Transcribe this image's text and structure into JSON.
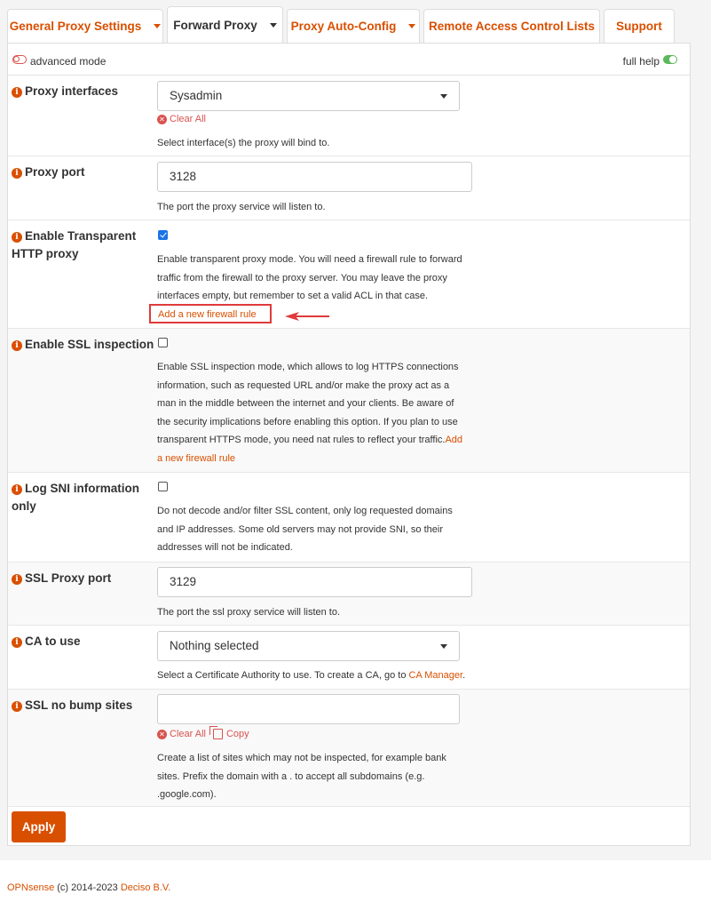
{
  "tabs": [
    {
      "label": "General Proxy Settings"
    },
    {
      "label": "Forward Proxy"
    },
    {
      "label": "Proxy Auto-Config"
    },
    {
      "label": "Remote Access Control Lists"
    },
    {
      "label": "Support"
    }
  ],
  "modebar": {
    "left": "advanced mode",
    "right": "full help"
  },
  "fields": {
    "proxy_interfaces": {
      "label": "Proxy interfaces",
      "value": "Sysadmin",
      "clear": "Clear All",
      "help": "Select interface(s) the proxy will bind to."
    },
    "proxy_port": {
      "label": "Proxy port",
      "value": "3128",
      "help": "The port the proxy service will listen to."
    },
    "transparent": {
      "label": "Enable Transparent HTTP proxy",
      "checked": true,
      "help": "Enable transparent proxy mode. You will need a firewall rule to forward traffic from the firewall to the proxy server. You may leave the proxy interfaces empty, but remember to set a valid ACL in that case.",
      "link": "Add a new firewall rule"
    },
    "ssl_inspection": {
      "label": "Enable SSL inspection",
      "checked": false,
      "help": "Enable SSL inspection mode, which allows to log HTTPS connections information, such as requested URL and/or make the proxy act as a man in the middle between the internet and your clients. Be aware of the security implications before enabling this option. If you plan to use transparent HTTPS mode, you need nat rules to reflect your traffic.",
      "link": "Add a new firewall rule"
    },
    "sni_only": {
      "label": "Log SNI information only",
      "checked": false,
      "help": "Do not decode and/or filter SSL content, only log requested domains and IP addresses. Some old servers may not provide SNI, so their addresses will not be indicated."
    },
    "ssl_port": {
      "label": "SSL Proxy port",
      "value": "3129",
      "help": "The port the ssl proxy service will listen to."
    },
    "ca": {
      "label": "CA to use",
      "value": "Nothing selected",
      "help": "Select a Certificate Authority to use. To create a CA, go to",
      "link": "CA Manager",
      "tail": "."
    },
    "no_bump": {
      "label": "SSL no bump sites",
      "value": "",
      "clear": "Clear All",
      "copy": "Copy",
      "help": "Create a list of sites which may not be inspected, for example bank sites. Prefix the domain with a . to accept all subdomains (e.g. .google.com)."
    }
  },
  "apply_label": "Apply",
  "footer": {
    "brand": "OPNsense",
    "text": " (c) 2014-2023 ",
    "company": "Deciso B.V."
  },
  "colors": {
    "accent": "#d94f00",
    "danger": "#d9534f",
    "toggle_on": "#5cb85c",
    "annotation": "#e03a3a"
  }
}
